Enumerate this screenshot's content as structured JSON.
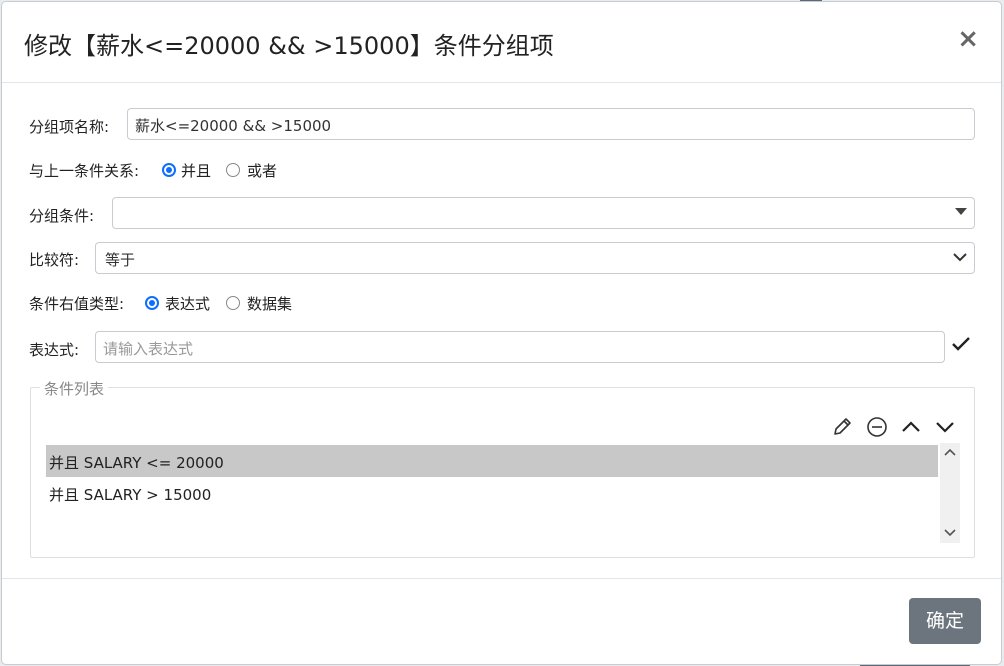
{
  "dialog": {
    "title": "修改【薪水<=20000 && >15000】条件分组项",
    "close_glyph": "×"
  },
  "form": {
    "group_name": {
      "label": "分组项名称:",
      "value": "薪水<=20000 && >15000"
    },
    "relation": {
      "label": "与上一条件关系:",
      "options": [
        "并且",
        "或者"
      ],
      "selected": "并且"
    },
    "group_condition": {
      "label": "分组条件:",
      "value": ""
    },
    "comparator": {
      "label": "比较符:",
      "value": "等于"
    },
    "right_value_type": {
      "label": "条件右值类型:",
      "options": [
        "表达式",
        "数据集"
      ],
      "selected": "表达式"
    },
    "expression": {
      "label": "表达式:",
      "value": "",
      "placeholder": "请输入表达式"
    }
  },
  "condition_list": {
    "legend": "条件列表",
    "items": [
      "并且 SALARY <= 20000",
      "并且 SALARY > 15000"
    ],
    "selected_index": 0,
    "tools": [
      "edit-icon",
      "remove-icon",
      "move-up-icon",
      "move-down-icon"
    ]
  },
  "footer": {
    "ok_label": "确定"
  },
  "colors": {
    "accent": "#0d6efd",
    "ok_button": "#6c757d",
    "selected_row": "#c8c8c8"
  }
}
